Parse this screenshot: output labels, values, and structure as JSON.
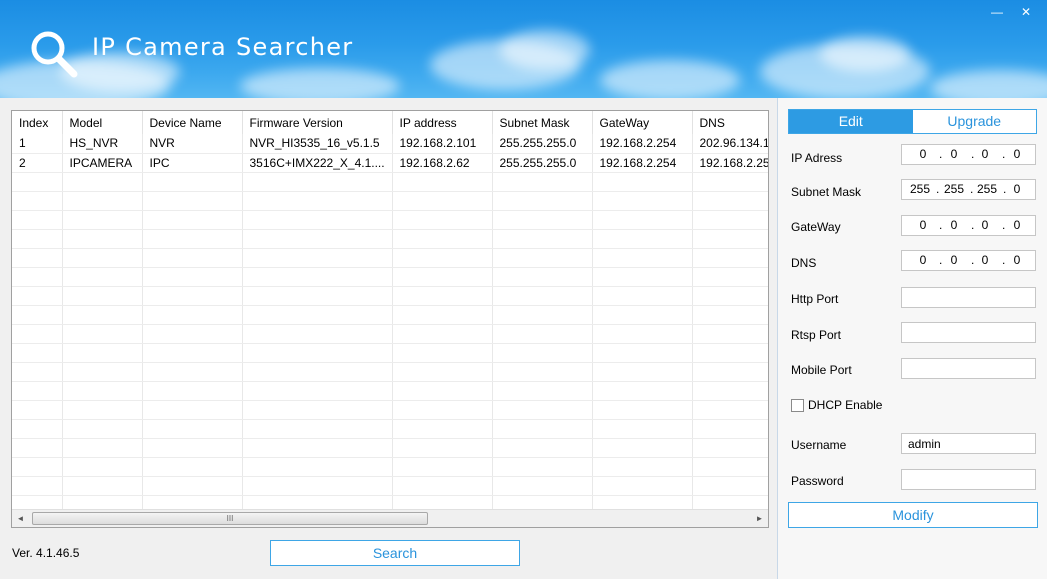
{
  "app": {
    "title": "IP Camera Searcher",
    "version": "Ver. 4.1.46.5",
    "minimize_icon": "—",
    "close_icon": "✕"
  },
  "colors": {
    "header_top": "#1b8de3",
    "accent": "#2d9be3",
    "accent_text": "#2a93dc"
  },
  "table": {
    "columns": [
      "Index",
      "Model",
      "Device Name",
      "Firmware Version",
      "IP address",
      "Subnet Mask",
      "GateWay",
      "DNS"
    ],
    "rows": [
      [
        "1",
        "HS_NVR",
        "NVR",
        "NVR_HI3535_16_v5.1.5",
        "192.168.2.101",
        "255.255.255.0",
        "192.168.2.254",
        "202.96.134.1"
      ],
      [
        "2",
        "IPCAMERA",
        "IPC",
        "3516C+IMX222_X_4.1....",
        "192.168.2.62",
        "255.255.255.0",
        "192.168.2.254",
        "192.168.2.25"
      ]
    ],
    "scroll": {
      "left_arrow": "◄",
      "right_arrow": "►",
      "thumb_grip": "III"
    }
  },
  "buttons": {
    "search": "Search",
    "modify": "Modify"
  },
  "tabs": {
    "edit": "Edit",
    "upgrade": "Upgrade"
  },
  "form": {
    "ip_address": {
      "label": "IP Adress",
      "octets": [
        "0",
        "0",
        "0",
        "0"
      ]
    },
    "subnet_mask": {
      "label": "Subnet Mask",
      "octets": [
        "255",
        "255",
        "255",
        "0"
      ]
    },
    "gateway": {
      "label": "GateWay",
      "octets": [
        "0",
        "0",
        "0",
        "0"
      ]
    },
    "dns": {
      "label": "DNS",
      "octets": [
        "0",
        "0",
        "0",
        "0"
      ]
    },
    "http_port": {
      "label": "Http Port",
      "value": ""
    },
    "rtsp_port": {
      "label": "Rtsp Port",
      "value": ""
    },
    "mobile_port": {
      "label": "Mobile Port",
      "value": ""
    },
    "dhcp": {
      "label": "DHCP Enable",
      "checked": false
    },
    "username": {
      "label": "Username",
      "value": "admin"
    },
    "password": {
      "label": "Password",
      "value": ""
    }
  }
}
